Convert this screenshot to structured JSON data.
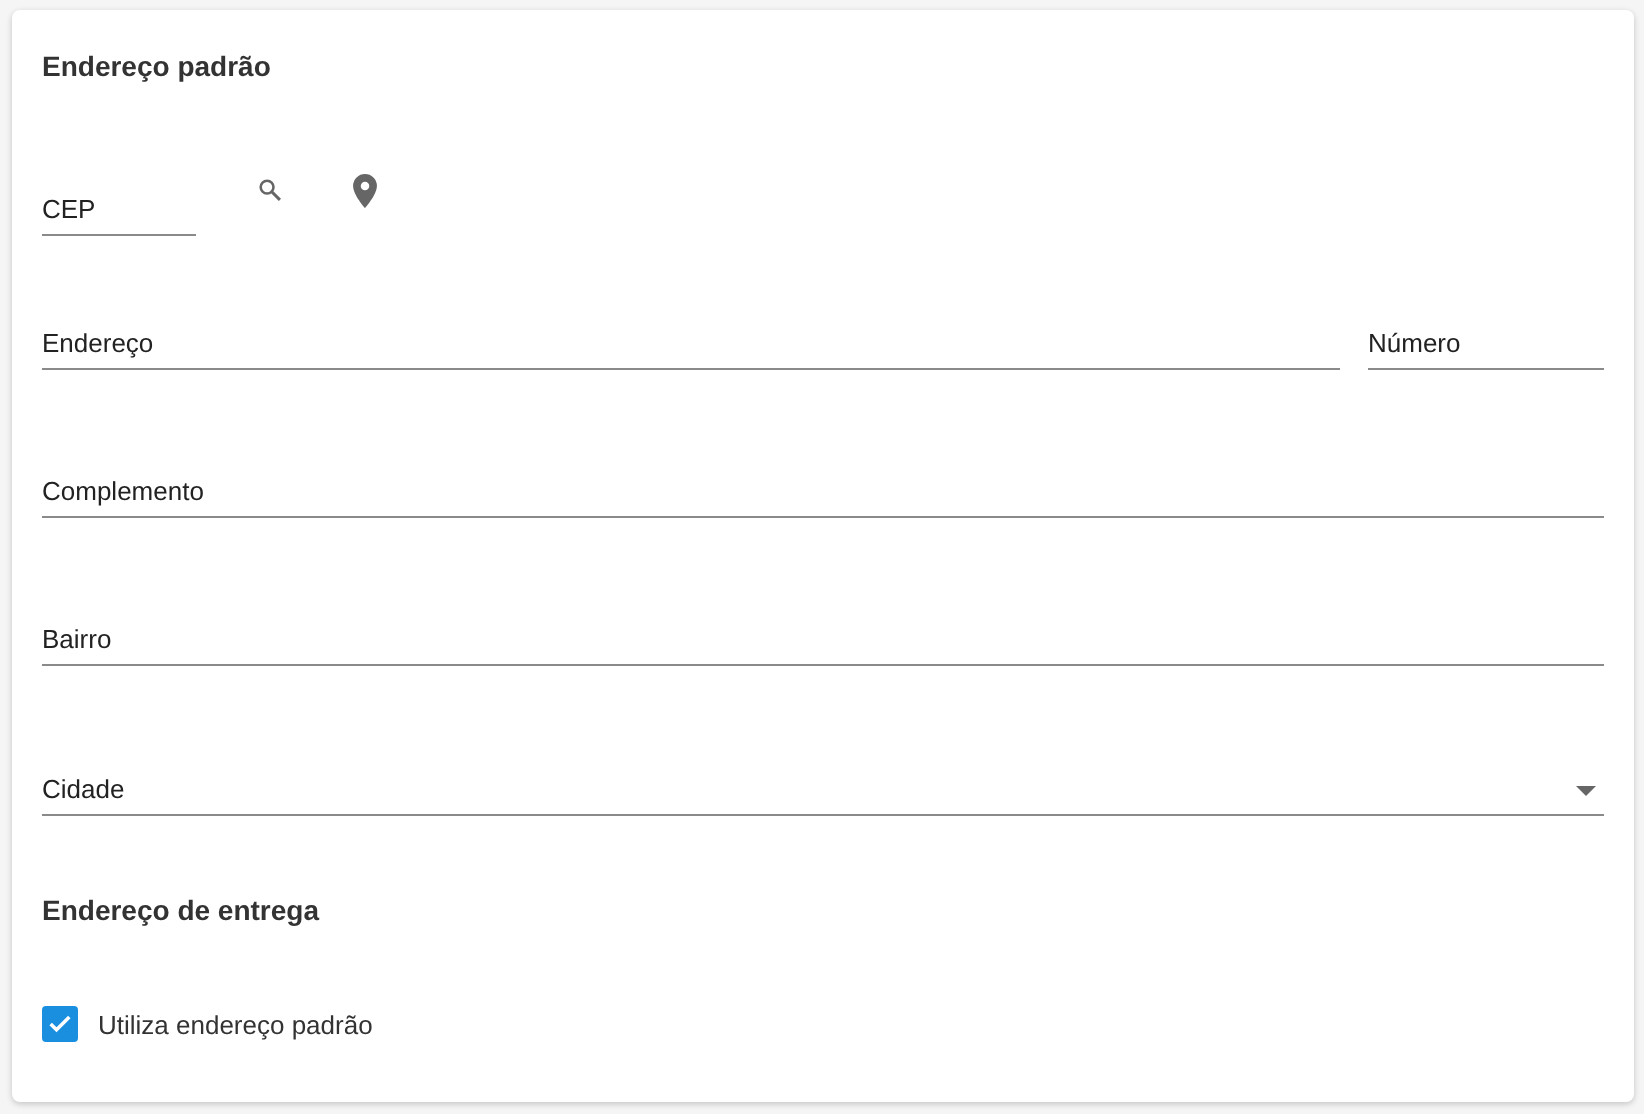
{
  "default_address": {
    "title": "Endereço padrão",
    "rows": [
      [
        {
          "kind": "text",
          "placeholder": "CEP"
        }
      ],
      [
        {
          "kind": "text",
          "placeholder": "Endereço"
        },
        {
          "kind": "text",
          "placeholder": "Número"
        }
      ],
      [
        {
          "kind": "text",
          "placeholder": "Complemento"
        }
      ],
      [
        {
          "kind": "text",
          "placeholder": "Bairro"
        }
      ],
      [
        {
          "kind": "select",
          "placeholder": "Cidade"
        }
      ]
    ]
  },
  "delivery_address": {
    "title": "Endereço de entrega",
    "checkbox": {
      "label": "Utiliza endereço padrão",
      "checked": true
    }
  }
}
